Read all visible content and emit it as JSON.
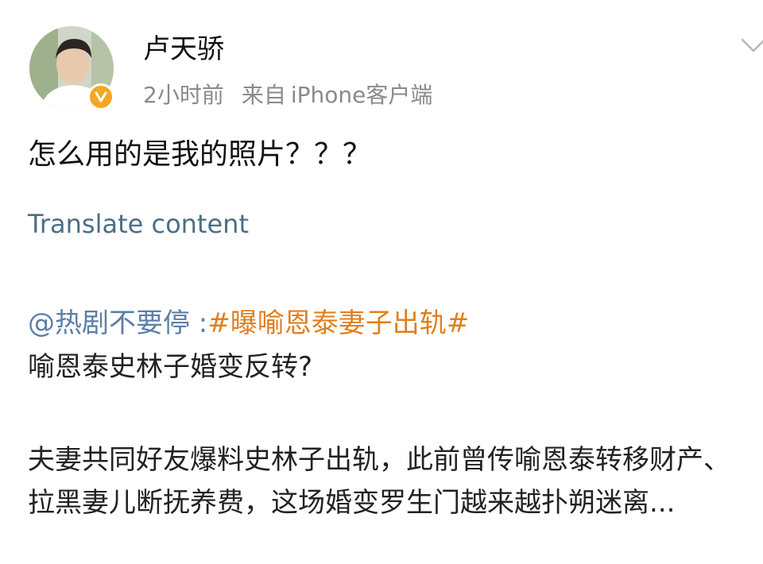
{
  "post": {
    "author": {
      "name": "卢天骄",
      "verified_color": "#f5a623"
    },
    "meta": {
      "time": "2小时前",
      "source_label": "来自",
      "source_client": "iPhone客户端"
    },
    "text": "怎么用的是我的照片？？？",
    "translate_link": "Translate content"
  },
  "repost": {
    "mention": "@热剧不要停",
    "separator": " :",
    "hashtag": "#曝喻恩泰妻子出轨#",
    "headline": "喻恩泰史林子婚变反转?",
    "body": "夫妻共同好友爆料史林子出轨，此前曾传喻恩泰转移财产、拉黑妻儿断抚养费，这场婚变罗生门越来越扑朔迷离..."
  },
  "icons": {
    "more": "chevron-down-icon",
    "verified": "verified-badge-icon"
  },
  "colors": {
    "link_blue": "#5b7fa6",
    "hashtag_orange": "#e07f1d",
    "meta_gray": "#8a8a8a"
  }
}
